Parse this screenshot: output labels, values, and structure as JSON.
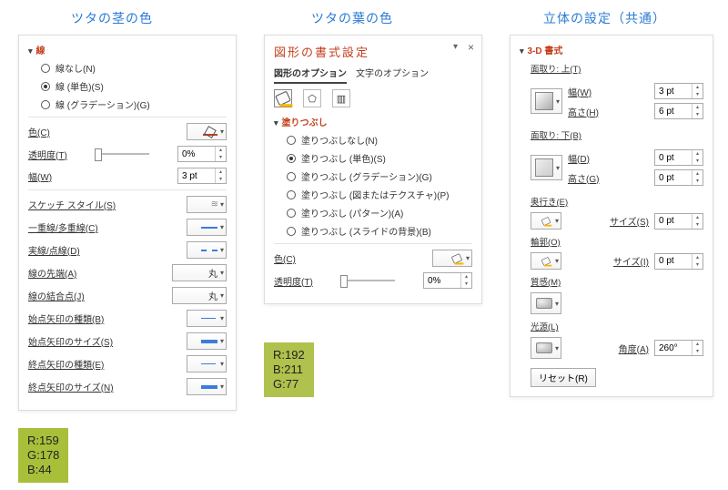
{
  "headings": {
    "left": "ツタの茎の色",
    "center": "ツタの葉の色",
    "right": "立体の設定（共通）"
  },
  "line_panel": {
    "section": "線",
    "opt_none": "線なし(N)",
    "opt_solid": "線 (単色)(S)",
    "opt_grad": "線 (グラデーション)(G)",
    "color_lbl": "色(C)",
    "trans_lbl": "透明度(T)",
    "trans_val": "0%",
    "width_lbl": "幅(W)",
    "width_val": "3 pt",
    "sketch_lbl": "スケッチ スタイル(S)",
    "compound_lbl": "一重線/多重線(C)",
    "dash_lbl": "実線/点線(D)",
    "cap_lbl": "線の先端(A)",
    "cap_val": "丸",
    "join_lbl": "線の結合点(J)",
    "join_val": "丸",
    "begin_type_lbl": "始点矢印の種類(B)",
    "begin_size_lbl": "始点矢印のサイズ(S)",
    "end_type_lbl": "終点矢印の種類(E)",
    "end_size_lbl": "終点矢印のサイズ(N)"
  },
  "fill_panel": {
    "title": "図形の書式設定",
    "tab_shape": "図形のオプション",
    "tab_text": "文字のオプション",
    "section": "塗りつぶし",
    "opt_none": "塗りつぶしなし(N)",
    "opt_solid": "塗りつぶし (単色)(S)",
    "opt_grad": "塗りつぶし (グラデーション)(G)",
    "opt_tex": "塗りつぶし (図またはテクスチャ)(P)",
    "opt_pat": "塗りつぶし (パターン)(A)",
    "opt_slide": "塗りつぶし (スライドの背景)(B)",
    "color_lbl": "色(C)",
    "trans_lbl": "透明度(T)",
    "trans_val": "0%"
  },
  "three_d": {
    "section": "3-D 書式",
    "bevel_top": "面取り: 上(T)",
    "bevel_bottom": "面取り: 下(B)",
    "width_lbl": "幅(W)",
    "height_lbl_top": "高さ(H)",
    "width_val_top": "3 pt",
    "height_val_top": "6 pt",
    "width_lbl_b": "幅(D)",
    "height_lbl_b": "高さ(G)",
    "val_zero": "0 pt",
    "depth_lbl": "奥行き(E)",
    "size_lbl_s": "サイズ(S)",
    "contour_lbl": "輪郭(O)",
    "size_lbl_i": "サイズ(I)",
    "material_lbl": "質感(M)",
    "light_lbl": "光源(L)",
    "angle_lbl": "角度(A)",
    "angle_val": "260°",
    "reset": "リセット(R)"
  },
  "swatches": {
    "stem": "R:159\nG:178\nB:44",
    "leaf": "R:192\nB:211\nG:77"
  }
}
